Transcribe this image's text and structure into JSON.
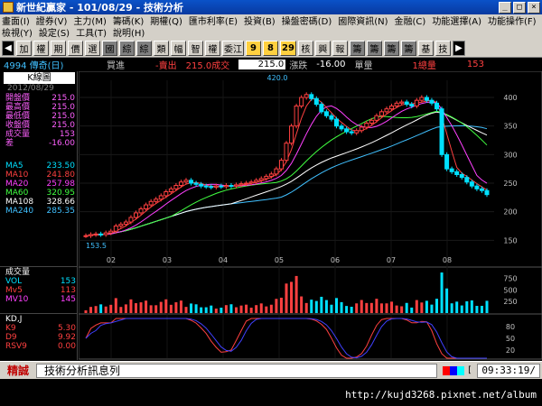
{
  "window": {
    "title": "新世紀贏家 - 101/08/29 - 技術分析"
  },
  "menu": {
    "row1": [
      "畫面(I)",
      "證券(V)",
      "主力(M)",
      "籌碼(K)",
      "期權(Q)",
      "匯市利率(E)",
      "投資(B)",
      "操盤密碼(D)",
      "國際資訊(N)",
      "金融(C)",
      "功能選擇(A)",
      "功能操作(F)"
    ],
    "row2": [
      "檢視(Y)",
      "設定(S)",
      "工具(T)",
      "說明(H)"
    ]
  },
  "toolbar": {
    "buttons": [
      {
        "label": "◀",
        "style": "arrow"
      },
      {
        "label": "加",
        "style": ""
      },
      {
        "label": "權",
        "style": ""
      },
      {
        "label": "期",
        "style": ""
      },
      {
        "label": "價",
        "style": ""
      },
      {
        "label": "選",
        "style": ""
      },
      {
        "label": "國",
        "style": "dark"
      },
      {
        "label": "綜",
        "style": "dark"
      },
      {
        "label": "綜",
        "style": "dark"
      },
      {
        "label": "類",
        "style": ""
      },
      {
        "label": "幅",
        "style": ""
      },
      {
        "label": "智",
        "style": ""
      },
      {
        "label": "權",
        "style": ""
      },
      {
        "label": "委江",
        "style": ""
      },
      {
        "label": "9",
        "style": "num"
      },
      {
        "label": "8",
        "style": "num"
      },
      {
        "label": "29",
        "style": "num"
      },
      {
        "label": "核",
        "style": ""
      },
      {
        "label": "興",
        "style": ""
      },
      {
        "label": "報",
        "style": ""
      },
      {
        "label": "籌",
        "style": "dark"
      },
      {
        "label": "籌",
        "style": "dark"
      },
      {
        "label": "籌",
        "style": "dark"
      },
      {
        "label": "籌",
        "style": "dark"
      },
      {
        "label": "基",
        "style": ""
      },
      {
        "label": "技",
        "style": ""
      },
      {
        "label": "▶",
        "style": "arrow"
      }
    ]
  },
  "info": {
    "stock": "4994 傳奇(日)",
    "buy_label": "買進",
    "sell_label": "-賣出",
    "trade_value": "215.0成交",
    "trade_box": "215.0",
    "change_label": "漲跌",
    "change_value": "-16.00",
    "vol_label": "單量",
    "vol_value": "1總量",
    "total_value": "153"
  },
  "left": {
    "kline_label": "K線圖",
    "date": "2012/08/29",
    "quote": [
      {
        "k": "開盤價",
        "v": "215.0",
        "c": "#ff60ff"
      },
      {
        "k": "最高價",
        "v": "215.0",
        "c": "#ff60ff"
      },
      {
        "k": "最低價",
        "v": "215.0",
        "c": "#ff60ff"
      },
      {
        "k": "收盤價",
        "v": "215.0",
        "c": "#ff60ff"
      },
      {
        "k": "成交量",
        "v": "153",
        "c": "#ff60ff"
      },
      {
        "k": "差",
        "v": "-16.00",
        "c": "#ff60ff"
      }
    ],
    "ma": [
      {
        "k": "MA5",
        "v": "233.50",
        "c": "#00e0ff"
      },
      {
        "k": "MA10",
        "v": "241.80",
        "c": "#ff4040"
      },
      {
        "k": "MA20",
        "v": "257.98",
        "c": "#ff40ff"
      },
      {
        "k": "MA60",
        "v": "320.95",
        "c": "#40ff40"
      },
      {
        "k": "MA108",
        "v": "328.66",
        "c": "#ffffff"
      },
      {
        "k": "MA240",
        "v": "285.35",
        "c": "#40c0ff"
      }
    ],
    "vol_title": "成交量",
    "vol": [
      {
        "k": "VOL",
        "v": "153",
        "c": "#00e0ff"
      },
      {
        "k": "Mv5",
        "v": "113",
        "c": "#ff4040"
      },
      {
        "k": "MV10",
        "v": "145",
        "c": "#ff40ff"
      }
    ],
    "kd_title": "KD,J",
    "kd": [
      {
        "k": "K9",
        "v": "5.30",
        "c": "#ff4040"
      },
      {
        "k": "D9",
        "v": "9.92",
        "c": "#ff4040"
      },
      {
        "k": "RSV9",
        "v": "0.00",
        "c": "#ff4040"
      }
    ]
  },
  "chart_data": [
    {
      "type": "candlestick",
      "title": "",
      "x_ticks": [
        "02",
        "03",
        "04",
        "05",
        "06",
        "07",
        "08"
      ],
      "y_ticks": [
        150,
        200,
        250,
        300,
        350,
        400
      ],
      "ylim": [
        130,
        430
      ],
      "annotations": {
        "high": "420.0",
        "low": "153.5"
      },
      "close": [
        158,
        160,
        161,
        160,
        163,
        166,
        175,
        178,
        182,
        190,
        198,
        205,
        212,
        218,
        222,
        228,
        235,
        240,
        246,
        252,
        255,
        250,
        248,
        245,
        244,
        243,
        245,
        244,
        246,
        245,
        247,
        249,
        250,
        252,
        255,
        258,
        262,
        266,
        275,
        290,
        320,
        350,
        385,
        400,
        405,
        398,
        388,
        375,
        368,
        362,
        350,
        345,
        340,
        338,
        342,
        348,
        355,
        360,
        368,
        375,
        380,
        385,
        390,
        392,
        388,
        385,
        395,
        400,
        395,
        390,
        380,
        300,
        275,
        270,
        265,
        260,
        252,
        245,
        240,
        237,
        230
      ]
    },
    {
      "type": "bar",
      "title": "",
      "y_ticks": [
        250,
        500,
        750
      ],
      "ylim": [
        0,
        900
      ]
    },
    {
      "type": "line",
      "title": "",
      "y_ticks": [
        20,
        50,
        80
      ],
      "ylim": [
        0,
        100
      ]
    }
  ],
  "status": {
    "lead": "精誠",
    "message": "技術分析訊息列",
    "time": "09:33:19/"
  },
  "url": "http://kujd3268.pixnet.net/album"
}
